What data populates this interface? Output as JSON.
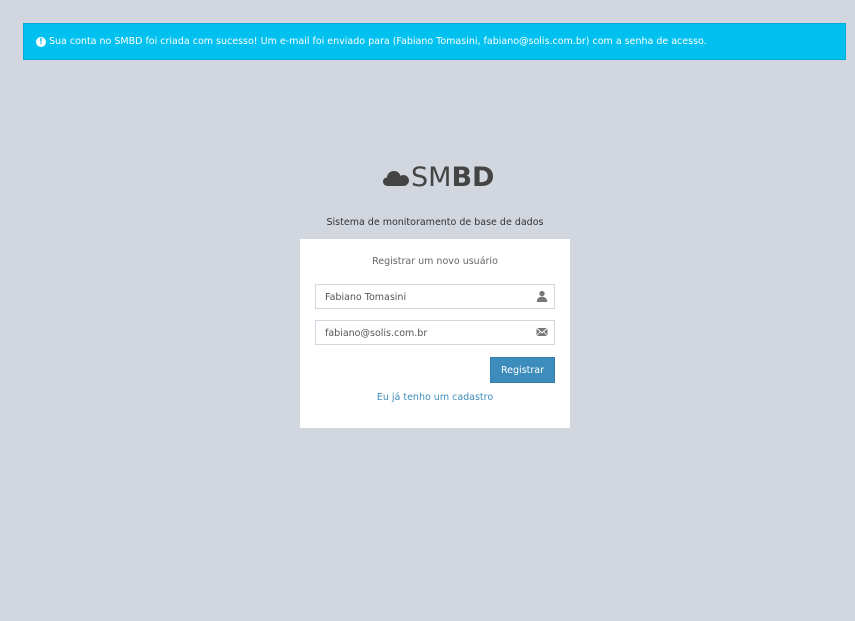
{
  "alert": {
    "icon": "exclamation-circle-icon",
    "message": "Sua conta no SMBD foi criada com sucesso! Um e-mail foi enviado para (Fabiano Tomasini, fabiano@solis.com.br) com a senha de acesso."
  },
  "logo": {
    "icon": "cloud-icon",
    "text_light": "SM",
    "text_bold": "BD"
  },
  "subtitle": "Sistema de monitoramento de base de dados",
  "register_box": {
    "title": "Registrar um novo usuário",
    "name_field": {
      "value": "Fabiano Tomasini",
      "icon": "user-icon"
    },
    "email_field": {
      "value": "fabiano@solis.com.br",
      "icon": "envelope-icon"
    },
    "submit_label": "Registrar",
    "login_link": "Eu já tenho um cadastro"
  },
  "colors": {
    "background": "#d2d6de",
    "alert": "#00c0ef",
    "primary": "#3c8dbc"
  }
}
